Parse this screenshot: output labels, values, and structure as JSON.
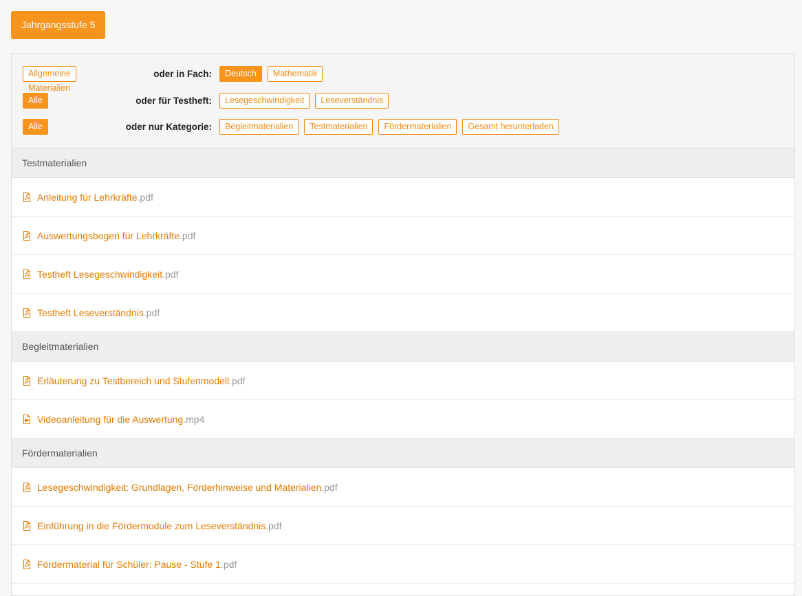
{
  "grade_button": "Jahrgangsstufe 5",
  "filters": {
    "row1": {
      "left_tag": "Allgemeine Materialien",
      "label": "oder in Fach:",
      "options": [
        {
          "label": "Deutsch",
          "active": true
        },
        {
          "label": "Mathematik",
          "active": false
        }
      ]
    },
    "row2": {
      "left_tag": "Alle",
      "label": "oder für Testheft:",
      "options": [
        {
          "label": "Lesegeschwindigkeit",
          "active": false
        },
        {
          "label": "Leseverständnis",
          "active": false
        }
      ]
    },
    "row3": {
      "left_tag": "Alle",
      "label": "oder nur Kategorie:",
      "options": [
        {
          "label": "Begleitmaterialien",
          "active": false
        },
        {
          "label": "Testmaterialien",
          "active": false
        },
        {
          "label": "Fördermaterialien",
          "active": false
        },
        {
          "label": "Gesamt herunterladen",
          "active": false
        }
      ]
    }
  },
  "sections": [
    {
      "title": "Testmaterialien",
      "items": [
        {
          "name": "Anleitung für Lehrkräfte",
          "ext": ".pdf",
          "icon": "pdf-icon"
        },
        {
          "name": "Auswertungsbogen für Lehrkräfte",
          "ext": ".pdf",
          "icon": "pdf-icon"
        },
        {
          "name": "Testheft Lesegeschwindigkeit",
          "ext": ".pdf",
          "icon": "pdf-icon"
        },
        {
          "name": "Testheft Leseverständnis",
          "ext": ".pdf",
          "icon": "pdf-icon"
        }
      ]
    },
    {
      "title": "Begleitmaterialien",
      "items": [
        {
          "name": "Erläuterung zu Testbereich und Stufenmodell",
          "ext": ".pdf",
          "icon": "pdf-icon"
        },
        {
          "name": "Videoanleitung für die Auswertung",
          "ext": ".mp4",
          "icon": "video-icon"
        }
      ]
    },
    {
      "title": "Fördermaterialien",
      "items": [
        {
          "name": "Lesegeschwindigkeit: Grundlagen, Förderhinweise und Materialien",
          "ext": ".pdf",
          "icon": "pdf-icon"
        },
        {
          "name": "Einführung in die Fördermodule zum Leseverständnis",
          "ext": ".pdf",
          "icon": "pdf-icon"
        },
        {
          "name": "Fördermaterial für Schüler: Pause - Stufe 1",
          "ext": ".pdf",
          "icon": "pdf-icon"
        }
      ]
    }
  ],
  "colors": {
    "accent": "#f7941d",
    "link": "#e37b00",
    "ext": "#999999"
  }
}
